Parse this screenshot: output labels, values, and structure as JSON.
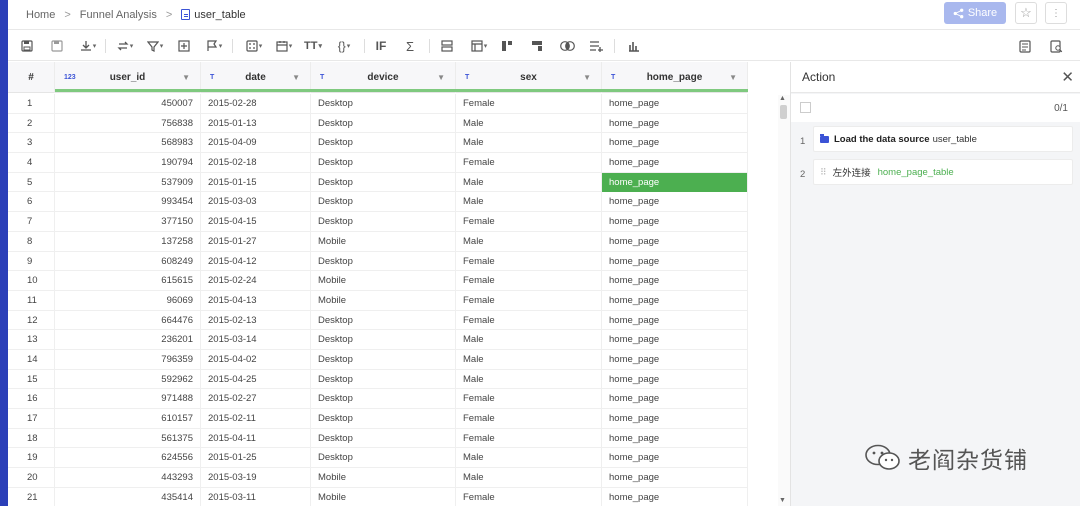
{
  "breadcrumb": {
    "home": "Home",
    "parent": "Funnel Analysis",
    "current": "user_table",
    "separator": ">"
  },
  "header": {
    "share_label": "Share",
    "accent": "#2b3fb8",
    "share_color": "#a9b8ee"
  },
  "toolbar": {
    "icons": [
      "save-icon",
      "save-as-icon",
      "download-icon",
      "transform-icon",
      "filter-icon",
      "add-column-icon",
      "flag-icon",
      "calculator-icon",
      "calendar-icon",
      "text-type-icon",
      "braces-icon",
      "if-icon",
      "sum-icon",
      "group-icon",
      "pivot-icon",
      "merge-icon",
      "split-icon",
      "join-icon",
      "append-icon",
      "chart-icon",
      "document-icon",
      "search-document-icon"
    ]
  },
  "table": {
    "index_header": "#",
    "columns": [
      {
        "name": "user_id",
        "type": "123"
      },
      {
        "name": "date",
        "type": "T"
      },
      {
        "name": "device",
        "type": "T"
      },
      {
        "name": "sex",
        "type": "T"
      },
      {
        "name": "home_page",
        "type": "T"
      }
    ],
    "rows": [
      [
        "1",
        "450007",
        "2015-02-28",
        "Desktop",
        "Female",
        "home_page"
      ],
      [
        "2",
        "756838",
        "2015-01-13",
        "Desktop",
        "Male",
        "home_page"
      ],
      [
        "3",
        "568983",
        "2015-04-09",
        "Desktop",
        "Male",
        "home_page"
      ],
      [
        "4",
        "190794",
        "2015-02-18",
        "Desktop",
        "Female",
        "home_page"
      ],
      [
        "5",
        "537909",
        "2015-01-15",
        "Desktop",
        "Male",
        "home_page"
      ],
      [
        "6",
        "993454",
        "2015-03-03",
        "Desktop",
        "Male",
        "home_page"
      ],
      [
        "7",
        "377150",
        "2015-04-15",
        "Desktop",
        "Female",
        "home_page"
      ],
      [
        "8",
        "137258",
        "2015-01-27",
        "Mobile",
        "Male",
        "home_page"
      ],
      [
        "9",
        "608249",
        "2015-04-12",
        "Desktop",
        "Female",
        "home_page"
      ],
      [
        "10",
        "615615",
        "2015-02-24",
        "Mobile",
        "Female",
        "home_page"
      ],
      [
        "11",
        "96069",
        "2015-04-13",
        "Mobile",
        "Female",
        "home_page"
      ],
      [
        "12",
        "664476",
        "2015-02-13",
        "Desktop",
        "Female",
        "home_page"
      ],
      [
        "13",
        "236201",
        "2015-03-14",
        "Desktop",
        "Male",
        "home_page"
      ],
      [
        "14",
        "796359",
        "2015-04-02",
        "Desktop",
        "Male",
        "home_page"
      ],
      [
        "15",
        "592962",
        "2015-04-25",
        "Desktop",
        "Male",
        "home_page"
      ],
      [
        "16",
        "971488",
        "2015-02-27",
        "Desktop",
        "Female",
        "home_page"
      ],
      [
        "17",
        "610157",
        "2015-02-11",
        "Desktop",
        "Female",
        "home_page"
      ],
      [
        "18",
        "561375",
        "2015-04-11",
        "Desktop",
        "Female",
        "home_page"
      ],
      [
        "19",
        "624556",
        "2015-01-25",
        "Desktop",
        "Male",
        "home_page"
      ],
      [
        "20",
        "443293",
        "2015-03-19",
        "Mobile",
        "Male",
        "home_page"
      ],
      [
        "21",
        "435414",
        "2015-03-11",
        "Mobile",
        "Female",
        "home_page"
      ]
    ],
    "selected_row": 5,
    "selected_color": "#4caf50"
  },
  "action_panel": {
    "title": "Action",
    "selection_count": "0/1",
    "steps": [
      {
        "num": "1",
        "bold": "Load the data source",
        "text": "user_table"
      },
      {
        "num": "2",
        "text": "左外连接",
        "highlight": "home_page_table"
      }
    ]
  },
  "watermark": {
    "text": "老阎杂货铺"
  }
}
